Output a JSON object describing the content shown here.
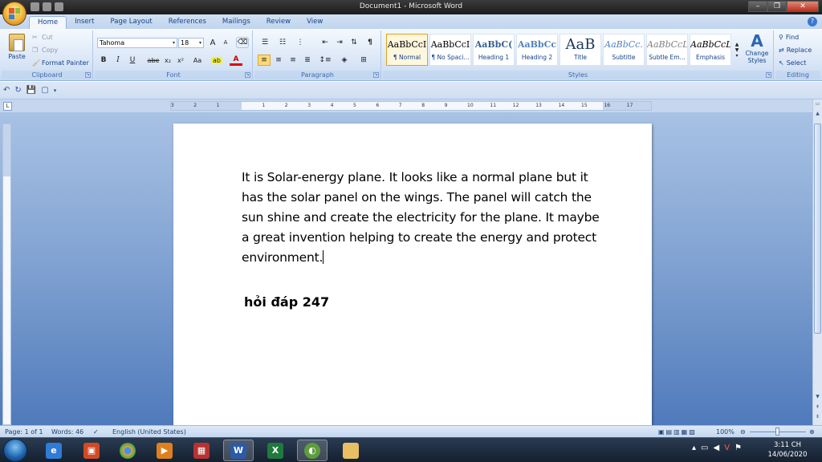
{
  "window": {
    "title": "Document1 - Microsoft Word"
  },
  "tabs": [
    "Home",
    "Insert",
    "Page Layout",
    "References",
    "Mailings",
    "Review",
    "View"
  ],
  "clipboard": {
    "paste": "Paste",
    "cut": "Cut",
    "copy": "Copy",
    "format_painter": "Format Painter",
    "label": "Clipboard"
  },
  "font": {
    "name": "Tahoma",
    "size": "18",
    "label": "Font",
    "grow": "A",
    "shrink": "A",
    "bold": "B",
    "italic": "I",
    "underline": "U",
    "strike": "abe",
    "subscript": "x₂",
    "superscript": "x²",
    "change_case": "Aa",
    "font_color": "A"
  },
  "paragraph": {
    "label": "Paragraph",
    "pilcrow": "¶"
  },
  "styles": {
    "label": "Styles",
    "items": [
      {
        "preview": "AaBbCcI",
        "name": "¶ Normal"
      },
      {
        "preview": "AaBbCcI",
        "name": "¶ No Spaci..."
      },
      {
        "preview": "AaBbC(",
        "name": "Heading 1"
      },
      {
        "preview": "AaBbCc",
        "name": "Heading 2"
      },
      {
        "preview": "AaB",
        "name": "Title"
      },
      {
        "preview": "AaBbCc.",
        "name": "Subtitle"
      },
      {
        "preview": "AaBbCcL",
        "name": "Subtle Em..."
      },
      {
        "preview": "AaBbCcL",
        "name": "Emphasis"
      }
    ],
    "change_styles": "Change Styles"
  },
  "editing": {
    "label": "Editing",
    "find": "Find",
    "replace": "Replace",
    "select": "Select"
  },
  "ruler": {
    "numbers": [
      "3",
      "2",
      "1",
      "1",
      "2",
      "3",
      "4",
      "5",
      "6",
      "7",
      "8",
      "9",
      "10",
      "11",
      "12",
      "13",
      "14",
      "15",
      "16",
      "17"
    ]
  },
  "document": {
    "body": "It is Solar-energy plane. It looks like a normal plane but it has the solar panel on the wings. The panel will catch the sun shine and create the electricity for the plane. It maybe a great invention helping to create the energy and protect environment.",
    "heading": "hỏi đáp 247"
  },
  "status": {
    "page": "Page: 1 of 1",
    "words": "Words: 46",
    "language": "English (United States)",
    "zoom": "100%"
  },
  "taskbar": {
    "time": "3:11 CH",
    "date": "14/06/2020",
    "word_icon_letter": "W",
    "excel_icon_letter": "X"
  }
}
